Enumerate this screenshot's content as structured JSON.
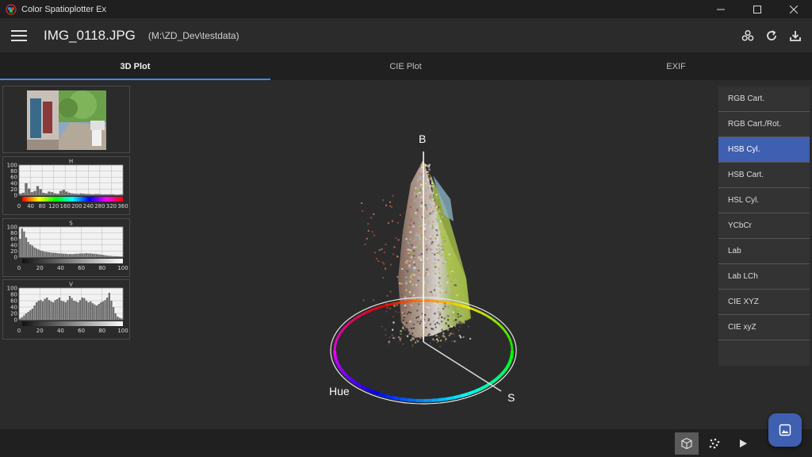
{
  "window": {
    "title": "Color Spatioplotter Ex",
    "controls": [
      "minimize-icon",
      "maximize-icon",
      "close-icon"
    ]
  },
  "appbar": {
    "file_name": "IMG_0118.JPG",
    "file_path": "(M:\\ZD_Dev\\testdata)",
    "actions": [
      "color-circles-icon",
      "refresh-icon",
      "download-icon"
    ]
  },
  "tabs": [
    {
      "label": "3D Plot",
      "active": true
    },
    {
      "label": "CIE Plot",
      "active": false
    },
    {
      "label": "EXIF",
      "active": false
    }
  ],
  "histograms": {
    "h": {
      "title": "H",
      "y_ticks": [
        "100",
        "80",
        "60",
        "40",
        "20",
        "0"
      ],
      "x_ticks": [
        "0",
        "40",
        "80",
        "120",
        "160",
        "200",
        "240",
        "280",
        "320",
        "360"
      ],
      "x_range": [
        0,
        360
      ],
      "values": [
        5,
        8,
        40,
        22,
        10,
        14,
        30,
        20,
        8,
        6,
        12,
        10,
        6,
        5,
        14,
        18,
        12,
        8,
        6,
        5,
        4,
        6,
        5,
        4,
        4,
        3,
        4,
        4,
        3,
        3,
        3,
        3,
        3,
        2,
        2,
        3
      ]
    },
    "s": {
      "title": "S",
      "y_ticks": [
        "100",
        "80",
        "60",
        "40",
        "20",
        "0"
      ],
      "x_ticks": [
        "0",
        "20",
        "40",
        "60",
        "80",
        "100"
      ],
      "x_range": [
        0,
        100
      ],
      "values": [
        60,
        95,
        85,
        65,
        50,
        42,
        38,
        32,
        28,
        25,
        22,
        20,
        18,
        17,
        16,
        15,
        14,
        14,
        13,
        12,
        12,
        11,
        11,
        10,
        10,
        10,
        10,
        11,
        11,
        12,
        12,
        12,
        13,
        12,
        12,
        11,
        11,
        10,
        9,
        8,
        7,
        6,
        5,
        4,
        4,
        3,
        3,
        3,
        2,
        2
      ]
    },
    "v": {
      "title": "V",
      "y_ticks": [
        "100",
        "80",
        "60",
        "40",
        "20",
        "0"
      ],
      "x_ticks": [
        "0",
        "20",
        "40",
        "60",
        "80",
        "100"
      ],
      "x_range": [
        0,
        100
      ],
      "values": [
        4,
        8,
        14,
        20,
        25,
        30,
        35,
        45,
        55,
        60,
        62,
        58,
        66,
        70,
        62,
        58,
        55,
        62,
        65,
        70,
        60,
        58,
        55,
        62,
        75,
        68,
        60,
        58,
        55,
        62,
        70,
        68,
        60,
        55,
        58,
        52,
        48,
        45,
        50,
        55,
        58,
        62,
        70,
        85,
        60,
        40,
        20,
        10,
        6,
        4
      ]
    }
  },
  "plot": {
    "axis_labels": {
      "b": "B",
      "hue": "Hue",
      "s": "S"
    }
  },
  "modes": [
    {
      "label": "RGB Cart.",
      "selected": false
    },
    {
      "label": "RGB Cart./Rot.",
      "selected": false
    },
    {
      "label": "HSB Cyl.",
      "selected": true
    },
    {
      "label": "HSB Cart.",
      "selected": false
    },
    {
      "label": "HSL Cyl.",
      "selected": false
    },
    {
      "label": "YCbCr",
      "selected": false
    },
    {
      "label": "Lab",
      "selected": false
    },
    {
      "label": "Lab LCh",
      "selected": false
    },
    {
      "label": "CIE XYZ",
      "selected": false
    },
    {
      "label": "CIE xyZ",
      "selected": false
    }
  ],
  "bottombar": {
    "buttons": [
      "cube-icon",
      "scatter-dots-icon",
      "play-icon"
    ],
    "active": "cube-icon"
  },
  "fab": {
    "icon": "image-icon"
  },
  "colors": {
    "accent": "#3f5fb0",
    "tab_indicator": "#3a8ee6",
    "background": "#2b2b2b"
  }
}
